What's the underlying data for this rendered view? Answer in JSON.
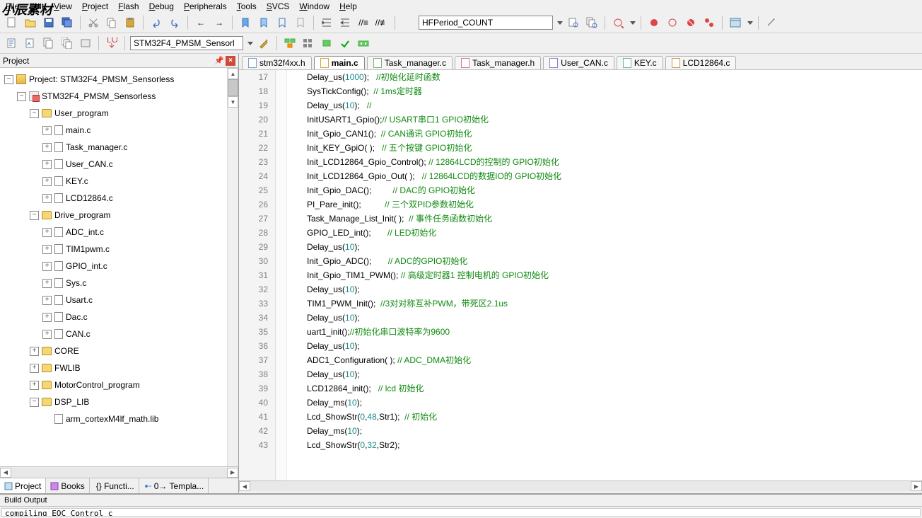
{
  "menu": [
    "File",
    "Edit",
    "View",
    "Project",
    "Flash",
    "Debug",
    "Peripherals",
    "Tools",
    "SVCS",
    "Window",
    "Help"
  ],
  "toolbar2_input": "STM32F4_PMSM_Sensorl",
  "search_combo": "HFPeriod_COUNT",
  "project_panel": {
    "title": "Project"
  },
  "tree": {
    "root": "Project: STM32F4_PMSM_Sensorless",
    "target": "STM32F4_PMSM_Sensorless",
    "groups": [
      {
        "name": "User_program",
        "expanded": true,
        "files": [
          "main.c",
          "Task_manager.c",
          "User_CAN.c",
          "KEY.c",
          "LCD12864.c"
        ]
      },
      {
        "name": "Drive_program",
        "expanded": true,
        "files": [
          "ADC_int.c",
          "TIM1pwm.c",
          "GPIO_int.c",
          "Sys.c",
          "Usart.c",
          "Dac.c",
          "CAN.c"
        ]
      },
      {
        "name": "CORE",
        "expanded": false,
        "files": []
      },
      {
        "name": "FWLIB",
        "expanded": false,
        "files": []
      },
      {
        "name": "MotorControl_program",
        "expanded": false,
        "files": []
      },
      {
        "name": "DSP_LIB",
        "expanded": true,
        "files": [
          "arm_cortexM4lf_math.lib"
        ]
      }
    ]
  },
  "bottom_tabs": [
    "Project",
    "Books",
    "{} Functi...",
    "0→ Templa..."
  ],
  "editor_tabs": [
    {
      "label": "stm32f4xx.h",
      "cls": "t1"
    },
    {
      "label": "main.c",
      "cls": "t2",
      "active": true
    },
    {
      "label": "Task_manager.c",
      "cls": "t3"
    },
    {
      "label": "Task_manager.h",
      "cls": "t4"
    },
    {
      "label": "User_CAN.c",
      "cls": "t5"
    },
    {
      "label": "KEY.c",
      "cls": "t6"
    },
    {
      "label": "LCD12864.c",
      "cls": "t7"
    }
  ],
  "code": {
    "first_line": 17,
    "lines": [
      {
        "t": "Delay_us(",
        "n": "1000",
        "r": ");   ",
        "c": "//初始化延时函数"
      },
      {
        "t": "SysTickConfig();  ",
        "c": "// 1ms定时器"
      },
      {
        "t": "Delay_us(",
        "n": "10",
        "r": ");   ",
        "c": "//"
      },
      {
        "t": "InitUSART1_Gpio();",
        "c": "// USART串口1 GPIO初始化"
      },
      {
        "t": "Init_Gpio_CAN1();  ",
        "c": "// CAN通讯 GPIO初始化"
      },
      {
        "t": "Init_KEY_GpiO( );   ",
        "c": "// 五个按键 GPIO初始化"
      },
      {
        "t": "Init_LCD12864_Gpio_Control(); ",
        "c": "// 12864LCD的控制的 GPIO初始化"
      },
      {
        "t": "Init_LCD12864_Gpio_Out( );   ",
        "c": "// 12864LCD的数据IO的 GPIO初始化"
      },
      {
        "t": "Init_Gpio_DAC();         ",
        "c": "// DAC的 GPIO初始化"
      },
      {
        "t": "PI_Pare_init();          ",
        "c": "// 三个双PID参数初始化"
      },
      {
        "t": "Task_Manage_List_Init( );  ",
        "c": "// 事件任务函数初始化"
      },
      {
        "t": "GPIO_LED_int();       ",
        "c": "// LED初始化"
      },
      {
        "t": "Delay_us(",
        "n": "10",
        "r": ");"
      },
      {
        "t": "Init_Gpio_ADC();       ",
        "c": "// ADC的GPIO初始化"
      },
      {
        "t": "Init_Gpio_TIM1_PWM(); ",
        "c": "// 高级定时器1 控制电机的 GPIO初始化"
      },
      {
        "t": "Delay_us(",
        "n": "10",
        "r": ");"
      },
      {
        "t": "TIM1_PWM_Init();  ",
        "c": "//3对对称互补PWM，带死区2.1us"
      },
      {
        "t": "Delay_us(",
        "n": "10",
        "r": ");"
      },
      {
        "t": "uart1_init();",
        "c": "//初始化串口波特率为9600"
      },
      {
        "t": "Delay_us(",
        "n": "10",
        "r": ");"
      },
      {
        "t": "ADC1_Configuration( ); ",
        "c": "// ADC_DMA初始化"
      },
      {
        "t": "Delay_us(",
        "n": "10",
        "r": ");"
      },
      {
        "t": "LCD12864_init();   ",
        "c": "// lcd 初始化"
      },
      {
        "t": "Delay_ms(",
        "n": "10",
        "r": ");"
      },
      {
        "t": "Lcd_ShowStr(",
        "n": "0",
        "r2": ",",
        "n2": "48",
        "r3": ",Str1);  ",
        "c": "// 初始化"
      },
      {
        "t": "Delay_ms(",
        "n": "10",
        "r": ");"
      },
      {
        "t": "Lcd_ShowStr(",
        "n": "0",
        "r2": ",",
        "n2": "32",
        "r3": ",Str2);"
      }
    ]
  },
  "build_output": {
    "title": "Build Output",
    "body": "compiling EOC Control c"
  }
}
